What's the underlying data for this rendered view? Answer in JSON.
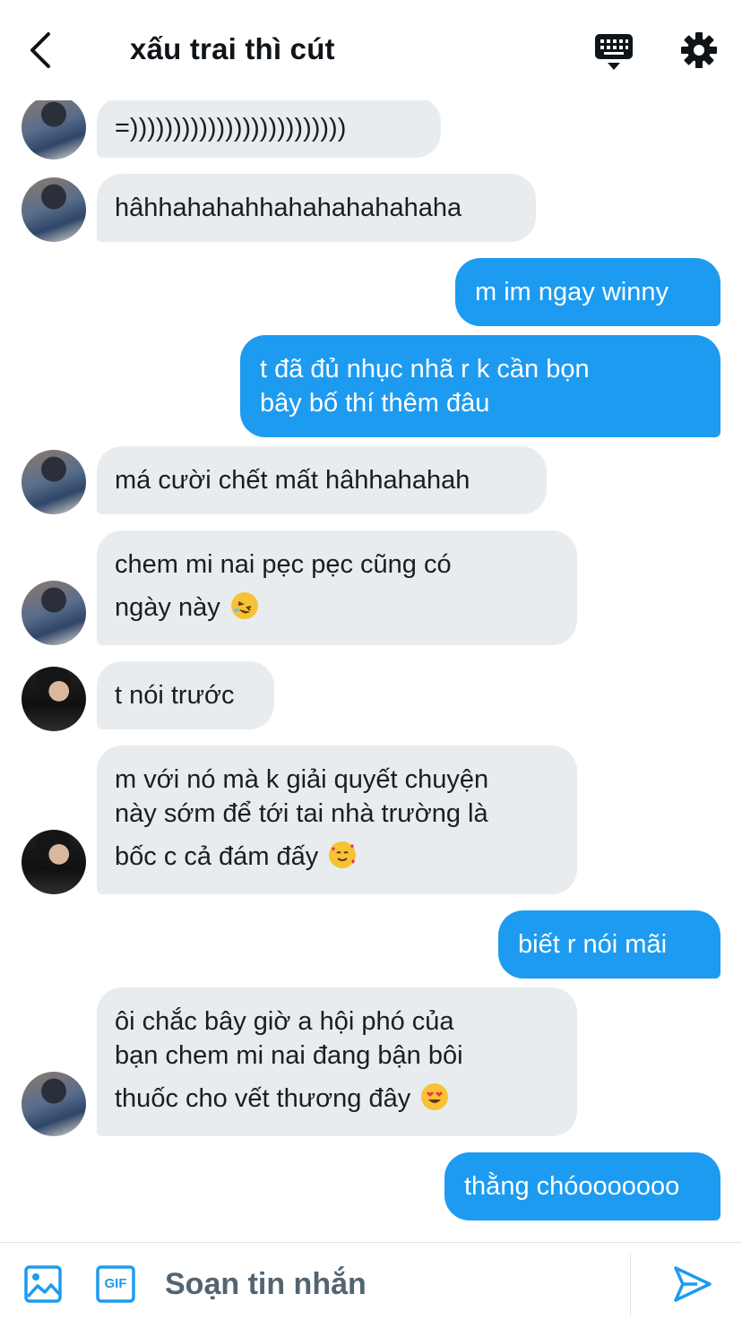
{
  "header": {
    "title": "xấu trai thì cút"
  },
  "composer": {
    "placeholder": "Soạn tin nhắn",
    "gif_label": "GIF"
  },
  "messages": [
    {
      "side": "in",
      "avatar": "a",
      "text": "=)))))))))))))))))))))))))"
    },
    {
      "side": "in",
      "avatar": "a",
      "text": "hâhhahahahhahahahahahaha"
    },
    {
      "side": "out",
      "text": "m im ngay winny"
    },
    {
      "side": "out",
      "lines": [
        "t đã đủ nhục nhã r k cần bọn",
        "bây bố thí thêm đâu"
      ]
    },
    {
      "side": "in",
      "avatar": "a",
      "text": "má cười chết mất hâhhahahah"
    },
    {
      "side": "in",
      "avatar": "a",
      "lines": [
        "chem mi nai pẹc pẹc cũng có",
        "ngày này"
      ],
      "emoji": "rolling-on-floor-laughing-emoji"
    },
    {
      "side": "in",
      "avatar": "b",
      "text": "t nói trước"
    },
    {
      "side": "in",
      "avatar": "b",
      "lines": [
        "m với nó mà k giải quyết chuyện",
        "này sớm để tới tai nhà trường là",
        "bốc c cả đám đấy"
      ],
      "emoji": "smiling-face-with-hearts-emoji"
    },
    {
      "side": "out",
      "text": "biết r nói mãi"
    },
    {
      "side": "in",
      "avatar": "a",
      "lines": [
        "ôi chắc bây giờ a hội phó của",
        "bạn chem mi nai đang bận bôi",
        "thuốc cho vết thương đây"
      ],
      "emoji": "heart-eyes-emoji"
    },
    {
      "side": "out",
      "text": "thằng chóooooooo"
    }
  ],
  "colors": {
    "outgoing_bubble": "#1d9bf0",
    "incoming_bubble": "#e9ecef",
    "icon_accent": "#1d9bf0"
  }
}
